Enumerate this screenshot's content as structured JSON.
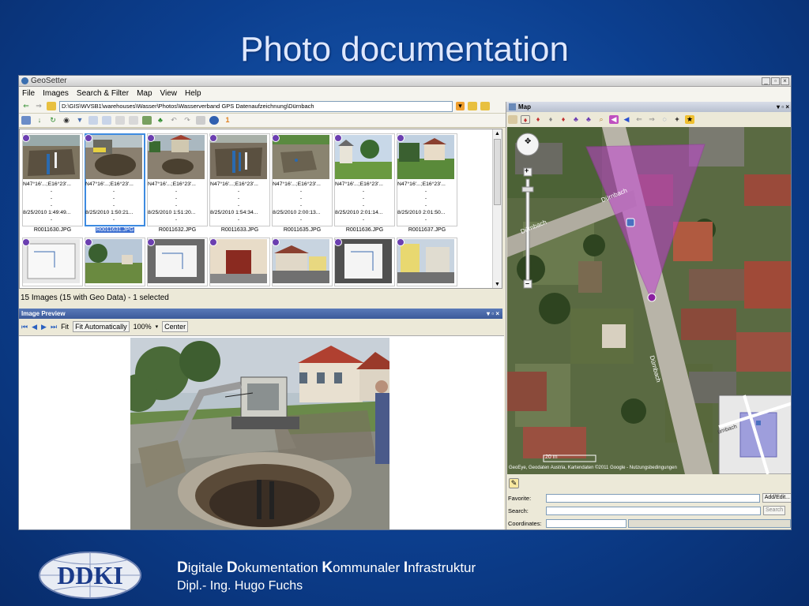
{
  "slide": {
    "title": "Photo documentation",
    "footer": {
      "brand_letters": [
        "D",
        "D",
        "K",
        "I"
      ],
      "brand_rest": [
        "igitale ",
        "okumentation ",
        "ommunaler ",
        "nfrastruktur"
      ],
      "author": "Dipl.- Ing. Hugo Fuchs",
      "logo_text": "DDKI"
    }
  },
  "app": {
    "title": "GeoSetter",
    "menu": [
      "File",
      "Images",
      "Search & Filter",
      "Map",
      "View",
      "Help"
    ],
    "path": "D:\\GIS\\WVSB1\\warehouses\\Wasser\\Photos\\Wasserverband GPS Datenaufzeichnung\\Dürnbach",
    "thumbnails": [
      {
        "coords": "N47°16'...;E16°23'...",
        "date": "8/25/2010 1:49:49...",
        "name": "R0011630.JPG",
        "selected": false
      },
      {
        "coords": "N47°16'...;E16°23'...",
        "date": "8/25/2010 1:50:21...",
        "name": "R0011631.JPG",
        "selected": true
      },
      {
        "coords": "N47°16'...;E16°23'...",
        "date": "8/25/2010 1:51:20...",
        "name": "R0011632.JPG",
        "selected": false
      },
      {
        "coords": "N47°16'...;E16°23'...",
        "date": "8/25/2010 1:54:34...",
        "name": "R0011633.JPG",
        "selected": false
      },
      {
        "coords": "N47°16'...;E16°23'...",
        "date": "8/25/2010 2:00:13...",
        "name": "R0011635.JPG",
        "selected": false
      },
      {
        "coords": "N47°16'...;E16°23'...",
        "date": "8/25/2010 2:01:14...",
        "name": "R0011636.JPG",
        "selected": false
      },
      {
        "coords": "N47°16'...;E16°23'...",
        "date": "8/25/2010 2:01:50...",
        "name": "R0011637.JPG",
        "selected": false
      }
    ],
    "status": "15 Images (15 with Geo Data) - 1 selected",
    "preview": {
      "header": "Image Preview",
      "fit_label": "Fit",
      "fit_mode": "Fit Automatically",
      "zoom": "100%",
      "center_label": "Center"
    },
    "map": {
      "header": "Map",
      "street_label_1": "Dürnbach",
      "street_label_2": "Dürnbach",
      "street_label_3": "Dürnbach",
      "overview_label": "ürnbach",
      "scale_label": "20 m",
      "attribution": "GeoEye, Geodaten Austria, Kartendaten ©2011 Google - Nutzungsbedingungen",
      "favorite_label": "Favorite:",
      "search_label": "Search:",
      "coordinates_label": "Coordinates:",
      "add_edit_label": "Add/Edit...",
      "search_button": "Search"
    }
  },
  "colors": {
    "slide_bg": "#0c3f8f",
    "selection": "#3d8be0",
    "geo_badge": "#6b3fb0",
    "map_cone": "#c040d0"
  }
}
